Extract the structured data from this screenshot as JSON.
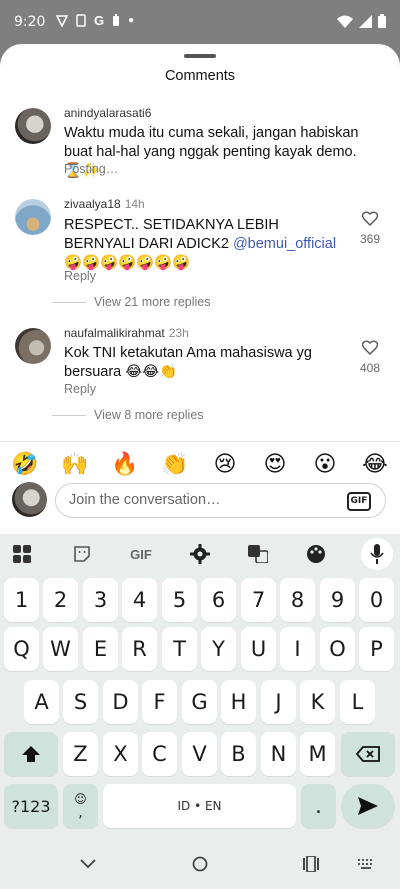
{
  "status_bar": {
    "time": "9:20"
  },
  "sheet": {
    "title": "Comments"
  },
  "comments": [
    {
      "username": "anindyalarasati6",
      "time": "",
      "text": "Waktu muda itu cuma sekali, jangan habiskan buat hal-hal yang nggak penting kayak demo. ⌛✨",
      "status": "Posting…"
    },
    {
      "username": "zivaalya18",
      "time": "14h",
      "text_before": "RESPECT.. SETIDAKNYA LEBIH BERNYALI DARI ADICK2 ",
      "mention": "@bemui_official",
      "text_after": " 🤪🤪🤪🤪🤪🤪🤪",
      "reply": "Reply",
      "likes": "369",
      "view_more": "View 21 more replies"
    },
    {
      "username": "naufalmalikirahmat",
      "time": "23h",
      "text": "Kok TNI ketakutan Ama mahasiswa yg bersuara 😂😂👏",
      "reply": "Reply",
      "likes": "408",
      "view_more": "View 8 more replies"
    }
  ],
  "emoji_bar": [
    "🤣",
    "🙌",
    "🔥",
    "👏",
    "😢",
    "😍",
    "😮",
    "😂"
  ],
  "composer": {
    "placeholder": "Join the conversation…",
    "gif_label": "GIF"
  },
  "keyboard": {
    "toolbar": {
      "gif_label": "GIF"
    },
    "row_numbers": [
      "1",
      "2",
      "3",
      "4",
      "5",
      "6",
      "7",
      "8",
      "9",
      "0"
    ],
    "row_1": [
      "Q",
      "W",
      "E",
      "R",
      "T",
      "Y",
      "U",
      "I",
      "O",
      "P"
    ],
    "row_2": [
      "A",
      "S",
      "D",
      "F",
      "G",
      "H",
      "J",
      "K",
      "L"
    ],
    "row_3": [
      "Z",
      "X",
      "C",
      "V",
      "B",
      "N",
      "M"
    ],
    "symbols_label": "?123",
    "comma_label": ",",
    "space_label": "ID • EN",
    "period_label": "."
  },
  "icons": {
    "status": [
      "signal-icon",
      "battery-icon",
      "wifi-icon"
    ],
    "like": "heart-outline-icon"
  }
}
